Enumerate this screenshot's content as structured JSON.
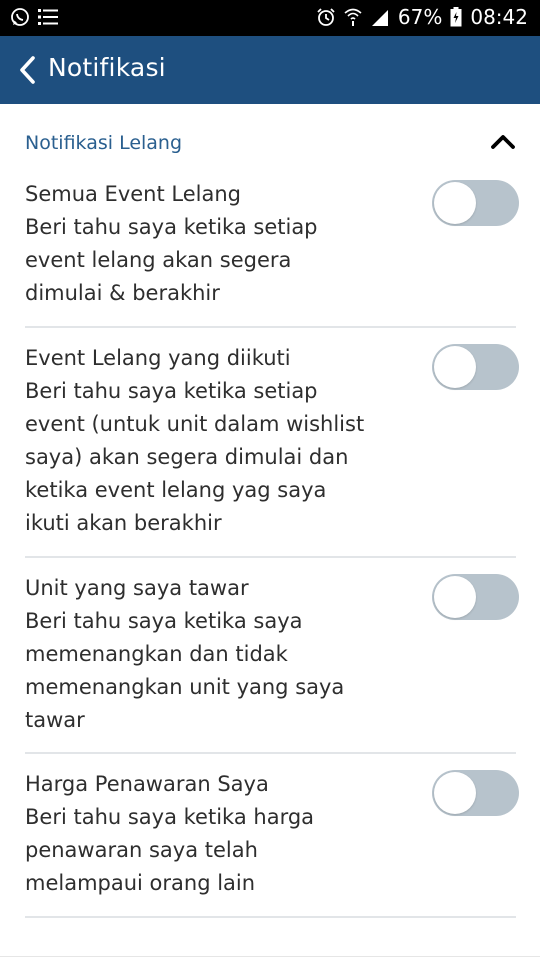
{
  "status_bar": {
    "left_icons": [
      "whatsapp-icon",
      "list-icon"
    ],
    "right_icons": [
      "alarm-icon",
      "wifi-icon",
      "signal-icon",
      "battery-icon"
    ],
    "battery_percent": "67%",
    "time": "08:42"
  },
  "app_bar": {
    "back_icon": "chevron-left-icon",
    "title": "Notifikasi",
    "color": "#1e4f7f"
  },
  "section": {
    "title": "Notifikasi Lelang",
    "collapse_icon": "chevron-up-icon",
    "color": "#2a5f8f"
  },
  "settings": [
    {
      "title": "Semua Event Lelang",
      "description": "Beri tahu saya ketika setiap event lelang akan segera dimulai & berakhir",
      "enabled": false
    },
    {
      "title": "Event Lelang yang diikuti",
      "description": "Beri tahu saya ketika setiap event (untuk unit dalam wishlist saya) akan segera dimulai dan ketika event lelang yag saya ikuti akan berakhir",
      "enabled": false
    },
    {
      "title": "Unit yang saya tawar",
      "description": "Beri tahu saya ketika saya memenangkan dan tidak memenangkan unit yang saya tawar",
      "enabled": false
    },
    {
      "title": "Harga Penawaran Saya",
      "description": "Beri tahu saya ketika harga penawaran saya telah melampaui orang lain",
      "enabled": false
    }
  ]
}
